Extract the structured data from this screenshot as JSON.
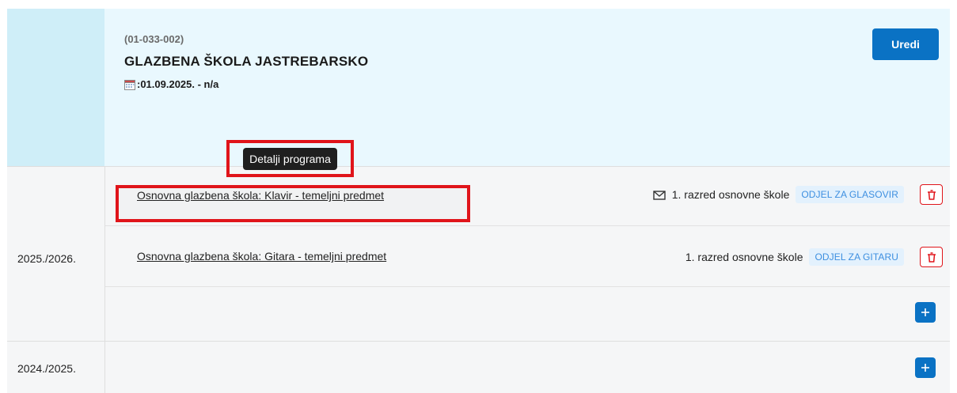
{
  "school": {
    "code": "(01-033-002)",
    "name": "GLAZBENA ŠKOLA JASTREBARSKO",
    "dates": ":01.09.2025. - n/a",
    "edit_label": "Uredi"
  },
  "tooltip": {
    "text": "Detalji programa"
  },
  "years": [
    {
      "label": "2025./2026.",
      "programs": [
        {
          "name": "Osnovna glazbena škola: Klavir - temeljni predmet",
          "grade": "1. razred osnovne škole",
          "department": "ODJEL ZA GLASOVIR",
          "has_mail_icon": true
        },
        {
          "name": "Osnovna glazbena škola: Gitara - temeljni predmet",
          "grade": "1. razred osnovne škole",
          "department": "ODJEL ZA GITARU",
          "has_mail_icon": false
        }
      ]
    },
    {
      "label": "2024./2025.",
      "programs": []
    }
  ],
  "icons": {
    "calendar": "calendar-icon",
    "mail": "mail-icon",
    "delete": "trash-icon",
    "add": "plus-icon"
  },
  "colors": {
    "primary": "#0a72c4",
    "danger": "#e0141a",
    "header_bg": "#e9f8fe",
    "header_left_bg": "#cfeef8",
    "badge_bg": "#e3f1fd",
    "badge_text": "#3d8fe0"
  }
}
